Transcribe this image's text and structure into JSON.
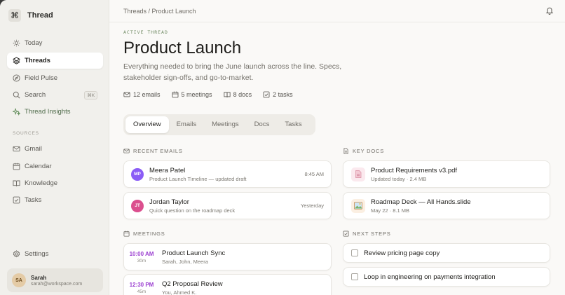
{
  "sidebar": {
    "brand": {
      "name": "Thread"
    },
    "nav": [
      {
        "label": "Today",
        "icon": "sun-icon"
      },
      {
        "label": "Threads",
        "icon": "layers-icon",
        "active": true
      },
      {
        "label": "Field Pulse",
        "icon": "compass-icon"
      },
      {
        "label": "Search",
        "icon": "search-icon",
        "shortcut": "⌘K"
      },
      {
        "label": "Thread Insights",
        "icon": "sparkle-icon"
      }
    ],
    "sources_label": "SOURCES",
    "sources": [
      {
        "label": "Gmail",
        "icon": "mail-icon"
      },
      {
        "label": "Calendar",
        "icon": "calendar-icon"
      },
      {
        "label": "Knowledge",
        "icon": "book-icon"
      },
      {
        "label": "Tasks",
        "icon": "check-square-icon"
      }
    ],
    "settings_label": "Settings",
    "user": {
      "initials": "SA",
      "name": "Sarah",
      "email": "sarah@workspace.com"
    }
  },
  "header": {
    "breadcrumb": "Threads / Product Launch"
  },
  "thread": {
    "eyebrow": "ACTIVE THREAD",
    "title": "Product Launch",
    "description": "Everything needed to bring the June launch across the line. Specs, stakeholder sign-offs, and go-to-market.",
    "stats": [
      {
        "label": "12 emails",
        "icon": "mail-icon"
      },
      {
        "label": "5 meetings",
        "icon": "calendar-icon"
      },
      {
        "label": "8 docs",
        "icon": "book-icon"
      },
      {
        "label": "2 tasks",
        "icon": "check-square-icon"
      }
    ],
    "tabs": [
      "Overview",
      "Emails",
      "Meetings",
      "Docs",
      "Tasks"
    ],
    "active_tab": "Overview"
  },
  "recent_emails": {
    "heading": "RECENT EMAILS",
    "items": [
      {
        "initials": "MP",
        "name": "Meera Patel",
        "subject": "Product Launch Timeline — updated draft",
        "time": "8:45 AM",
        "color": "#8b5cf6"
      },
      {
        "initials": "JT",
        "name": "Jordan Taylor",
        "subject": "Quick question on the roadmap deck",
        "time": "Yesterday",
        "color": "#db4f8e"
      }
    ]
  },
  "key_docs": {
    "heading": "KEY DOCS",
    "items": [
      {
        "name": "Product Requirements v3.pdf",
        "meta": "Updated today · 2.4 MB",
        "icon": "pdf-file-icon"
      },
      {
        "name": "Roadmap Deck — All Hands.slide",
        "meta": "May 22 · 8.1 MB",
        "icon": "slides-file-icon"
      }
    ]
  },
  "meetings": {
    "heading": "MEETINGS",
    "items": [
      {
        "time": "10:00 AM",
        "duration": "30m",
        "title": "Product Launch Sync",
        "attendees": "Sarah, John, Meera"
      },
      {
        "time": "12:30 PM",
        "duration": "45m",
        "title": "Q2 Proposal Review",
        "attendees": "You, Ahmed K."
      }
    ]
  },
  "next_steps": {
    "heading": "NEXT STEPS",
    "items": [
      {
        "label": "Review pricing page copy",
        "checked": false
      },
      {
        "label": "Loop in engineering on payments integration",
        "checked": false
      }
    ]
  },
  "colors": {
    "accent_green": "#6f8a62",
    "meeting_time": "#9b3fd0"
  }
}
